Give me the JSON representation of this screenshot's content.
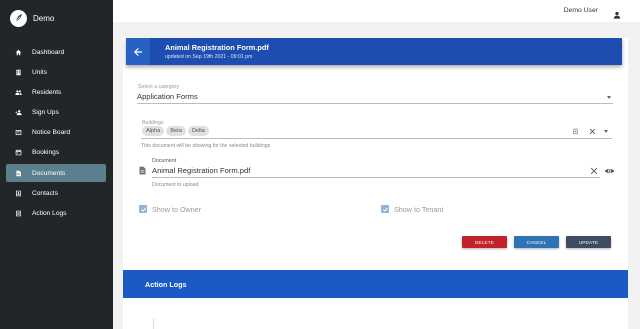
{
  "brand": {
    "name": "Demo"
  },
  "nav": [
    {
      "label": "Dashboard",
      "icon": "home-icon",
      "active": false
    },
    {
      "label": "Units",
      "icon": "building-icon",
      "active": false
    },
    {
      "label": "Residents",
      "icon": "people-icon",
      "active": false
    },
    {
      "label": "Sign Ups",
      "icon": "person-add-icon",
      "active": false
    },
    {
      "label": "Notice Board",
      "icon": "board-icon",
      "active": false
    },
    {
      "label": "Bookings",
      "icon": "calendar-icon",
      "active": false
    },
    {
      "label": "Documents",
      "icon": "document-icon",
      "active": true
    },
    {
      "label": "Contacts",
      "icon": "contacts-icon",
      "active": false
    },
    {
      "label": "Action Logs",
      "icon": "list-icon",
      "active": false
    }
  ],
  "topbar": {
    "user_name": "Demo User"
  },
  "header": {
    "title": "Animal Registration Form.pdf",
    "subtitle": "updated on Sep 19th 2021 - 09:01 pm"
  },
  "category": {
    "label": "Select a category",
    "value": "Application Forms"
  },
  "buildings": {
    "label": "Buildings",
    "chips": [
      "Alpha",
      "Beta",
      "Delta"
    ],
    "hint": "This document will be showing for the selected buildings"
  },
  "document": {
    "label": "Document",
    "value": "Animal Registration Form.pdf",
    "hint": "Document to upload"
  },
  "options": {
    "show_to_owner": {
      "label": "Show to Owner",
      "checked": true
    },
    "show_to_tenant": {
      "label": "Show to Tenant",
      "checked": true
    }
  },
  "buttons": {
    "delete": "DELETE",
    "cancel": "CANCEL",
    "update": "UPDATE"
  },
  "logs": {
    "title": "Action Logs"
  },
  "colors": {
    "sidebar": "#222629",
    "nav_active": "#5b7f8c",
    "header": "#1d4db0",
    "logs_bar": "#1b59c4",
    "delete": "#c3222b",
    "cancel": "#2e74b5",
    "update": "#3d4c60",
    "checkbox": "#90b4d8"
  }
}
